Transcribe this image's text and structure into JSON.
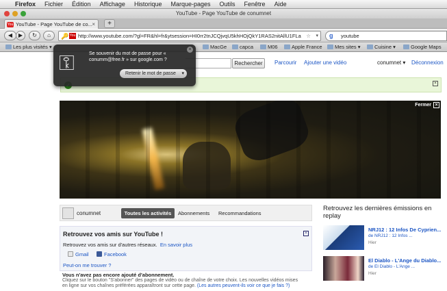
{
  "menubar": {
    "apple": "",
    "items": [
      "Firefox",
      "Fichier",
      "Édition",
      "Affichage",
      "Historique",
      "Marque-pages",
      "Outils",
      "Fenêtre",
      "Aide"
    ]
  },
  "window": {
    "title": "YouTube - Page YouTube de conumnet"
  },
  "tabs": [
    {
      "label": "YouTube - Page YouTube de co..."
    }
  ],
  "newtab": "+",
  "nav": {
    "url": "http://www.youtube.com/?gl=FR&hl=fr&ytsession=HI0rr2tnJCQjvqU5khHOjQkY1RAS2nitAllU1FLa",
    "search_value": "youtube",
    "search_engine": "g"
  },
  "bookmarks": [
    {
      "label": "Les plus visités",
      "dropdown": true
    },
    {
      "label": "MacGe"
    },
    {
      "label": "capca"
    },
    {
      "label": "M06"
    },
    {
      "label": "Apple France"
    },
    {
      "label": "Mes sites",
      "dropdown": true
    },
    {
      "label": "Cuisine",
      "dropdown": true
    },
    {
      "label": "Google Maps"
    }
  ],
  "password_popup": {
    "message": "Se souvenir du mot de passe pour « conumm@free.fr » sur google.com ?",
    "button": "Retenir le mot de passe"
  },
  "youtube": {
    "search_button": "Rechercher",
    "browse": "Parcourir",
    "upload": "Ajouter une vidéo",
    "username": "conumnet",
    "logout": "Déconnexion",
    "banner_close": "Fermer",
    "activity": {
      "user": "conumnet",
      "tabs": [
        "Toutes les activités",
        "Abonnements",
        "Recommandations"
      ]
    },
    "friends": {
      "title": "Retrouvez vos amis sur YouTube !",
      "text": "Retrouvez vos amis sur d'autres réseaux.",
      "learn_more": "En savoir plus",
      "gmail": "Gmail",
      "facebook": "Facebook",
      "who": "Peut-on me trouver ?"
    },
    "no_activity": {
      "title": "Vous n'avez pas encore ajouté d'abonnement.",
      "text": "Cliquez sur le bouton \"S'abonner\" des pages de vidéo ou de chaîne de votre choix. Les nouvelles vidéos mises en ligne sur vos chaînes préférées apparaîtront sur cette page.",
      "link": "(Les autres peuvent-ils voir ce que je fais ?)"
    },
    "replay": {
      "heading": "Retrouvez les dernières émissions en replay",
      "items": [
        {
          "title": "NRJ12 : 12 Infos De Cyprien...",
          "source": "de NRJ12 : 12 Infos ...",
          "date": "Hier"
        },
        {
          "title": "El Diablo - L'Ange du Diablo...",
          "source": "de El Diablo - L'Ange ...",
          "date": "Hier"
        }
      ]
    }
  },
  "colors": {
    "link": "#1b55c4",
    "green_notice": "#e9f6d9",
    "youtube_red": "#cc0000"
  }
}
